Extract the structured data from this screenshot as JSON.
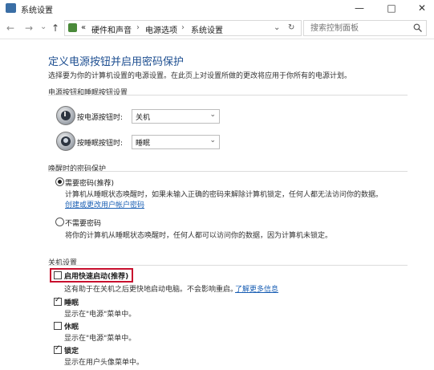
{
  "window": {
    "title": "系统设置",
    "controls": {
      "minimize": "—",
      "maximize": "□",
      "close": "✕"
    }
  },
  "nav": {
    "back": "←",
    "forward": "→",
    "dropdown": "⌄",
    "up": "↑",
    "refresh": "↻"
  },
  "breadcrumb": [
    "«",
    "硬件和声音",
    "›",
    "电源选项",
    "›",
    "系统设置"
  ],
  "search": {
    "placeholder": "搜索控制面板"
  },
  "page": {
    "title": "定义电源按钮并启用密码保护",
    "description": "选择要为你的计算机设置的电源设置。在此页上对设置所做的更改将应用于你所有的电源计划。"
  },
  "power_buttons": {
    "heading": "电源按钮和睡眠按钮设置",
    "power_label": "按电源按钮时:",
    "power_value": "关机",
    "sleep_label": "按睡眠按钮时:",
    "sleep_value": "睡眠"
  },
  "wake_password": {
    "heading": "唤醒时的密码保护",
    "require_label": "需要密码(推荐)",
    "require_selected": true,
    "require_desc": "计算机从睡眠状态唤醒时，如果未输入正确的密码来解除计算机锁定，任何人都无法访问你的数据。",
    "require_link": "创建或更改用户帐户密码",
    "norequire_label": "不需要密码",
    "norequire_selected": false,
    "norequire_desc": "将你的计算机从睡眠状态唤醒时，任何人都可以访问你的数据，因为计算机未锁定。"
  },
  "shutdown": {
    "heading": "关机设置",
    "fast_startup_label": "启用快速启动(推荐)",
    "fast_startup_checked": false,
    "fast_startup_desc": "这有助于在关机之后更快地启动电脑。不会影响重启。",
    "fast_startup_link": "了解更多信息",
    "sleep_label": "睡眠",
    "sleep_checked": true,
    "sleep_desc": "显示在\"电源\"菜单中。",
    "hibernate_label": "休眠",
    "hibernate_checked": false,
    "hibernate_desc": "显示在\"电源\"菜单中。",
    "lock_label": "锁定",
    "lock_checked": true,
    "lock_desc": "显示在用户头像菜单中。"
  },
  "colors": {
    "accent": "#1e4f91",
    "link": "#1a5fb4",
    "highlight": "#c8102e"
  }
}
